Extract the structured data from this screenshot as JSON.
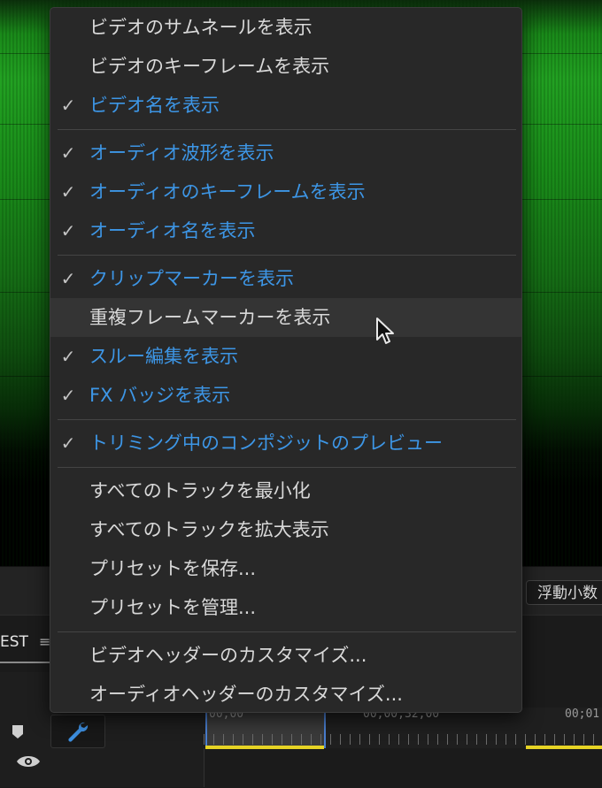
{
  "menu": {
    "groups": [
      [
        {
          "label": "ビデオのサムネールを表示",
          "checked": false
        },
        {
          "label": "ビデオのキーフレームを表示",
          "checked": false
        },
        {
          "label": "ビデオ名を表示",
          "checked": true
        }
      ],
      [
        {
          "label": "オーディオ波形を表示",
          "checked": true
        },
        {
          "label": "オーディオのキーフレームを表示",
          "checked": true
        },
        {
          "label": "オーディオ名を表示",
          "checked": true
        }
      ],
      [
        {
          "label": "クリップマーカーを表示",
          "checked": true
        },
        {
          "label": "重複フレームマーカーを表示",
          "checked": false,
          "hovered": true
        },
        {
          "label": "スルー編集を表示",
          "checked": true
        },
        {
          "label": "FX バッジを表示",
          "checked": true
        }
      ],
      [
        {
          "label": "トリミング中のコンポジットのプレビュー",
          "checked": true
        }
      ],
      [
        {
          "label": "すべてのトラックを最小化",
          "checked": false
        },
        {
          "label": "すべてのトラックを拡大表示",
          "checked": false
        },
        {
          "label": "プリセットを保存...",
          "checked": false
        },
        {
          "label": "プリセットを管理...",
          "checked": false
        }
      ],
      [
        {
          "label": "ビデオヘッダーのカスタマイズ...",
          "checked": false
        },
        {
          "label": "オーディオヘッダーのカスタマイズ...",
          "checked": false
        }
      ]
    ],
    "check_glyph": "✓"
  },
  "panel": {
    "precision_value": "浮動小数",
    "sequence_tab": "EST",
    "ruler_timecodes": [
      "00;00",
      "00;00;32;00",
      "00;01"
    ]
  },
  "colors": {
    "checked_text": "#3d96e6",
    "normal_text": "#d9d9d9",
    "menu_bg": "#282828",
    "playhead_region_border": "#4a7fd1",
    "work_area_bar": "#e6d325"
  },
  "icons": {
    "menu_hamburger": "hamburger-icon",
    "wrench": "wrench-icon",
    "marker": "marker-icon",
    "eye": "eye-icon",
    "cursor": "mouse-pointer-icon"
  }
}
